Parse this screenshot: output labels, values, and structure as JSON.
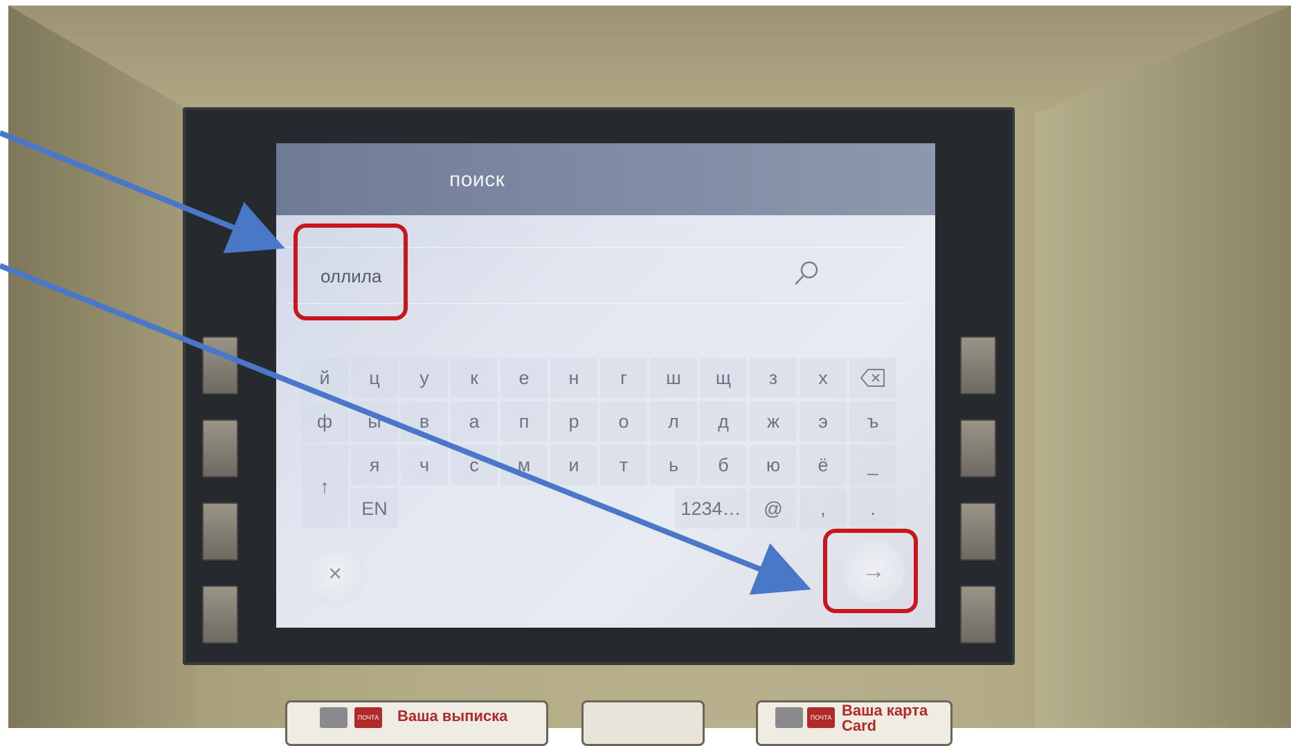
{
  "screen": {
    "title": "поиск",
    "search": {
      "value": "оллила",
      "icon": "search-icon"
    },
    "keyboard": {
      "rows": [
        [
          "й",
          "ц",
          "у",
          "к",
          "е",
          "н",
          "г",
          "ш",
          "щ",
          "з",
          "х"
        ],
        [
          "ф",
          "ы",
          "в",
          "а",
          "п",
          "р",
          "о",
          "л",
          "д",
          "ж",
          "э",
          "ъ"
        ],
        [
          "я",
          "ч",
          "с",
          "м",
          "и",
          "т",
          "ь",
          "б",
          "ю",
          "ё",
          "_"
        ]
      ],
      "backspace_icon": "backspace-icon",
      "shift_label": "↑",
      "lang_label": "EN",
      "numbers_label": "1234…",
      "at_label": "@",
      "comma_label": ",",
      "period_label": "."
    },
    "cancel_label": "×",
    "next_label": "→"
  },
  "atm_labels": {
    "left_logo_text": "ПОЧТА",
    "left_label": "Ваша выписка",
    "right_logo_text": "ПОЧТА",
    "right_label": "Ваша карта",
    "right_label_sub": "Card"
  },
  "annotations": {
    "highlight_color": "#c8161d",
    "arrow_color": "#4a78c8"
  }
}
